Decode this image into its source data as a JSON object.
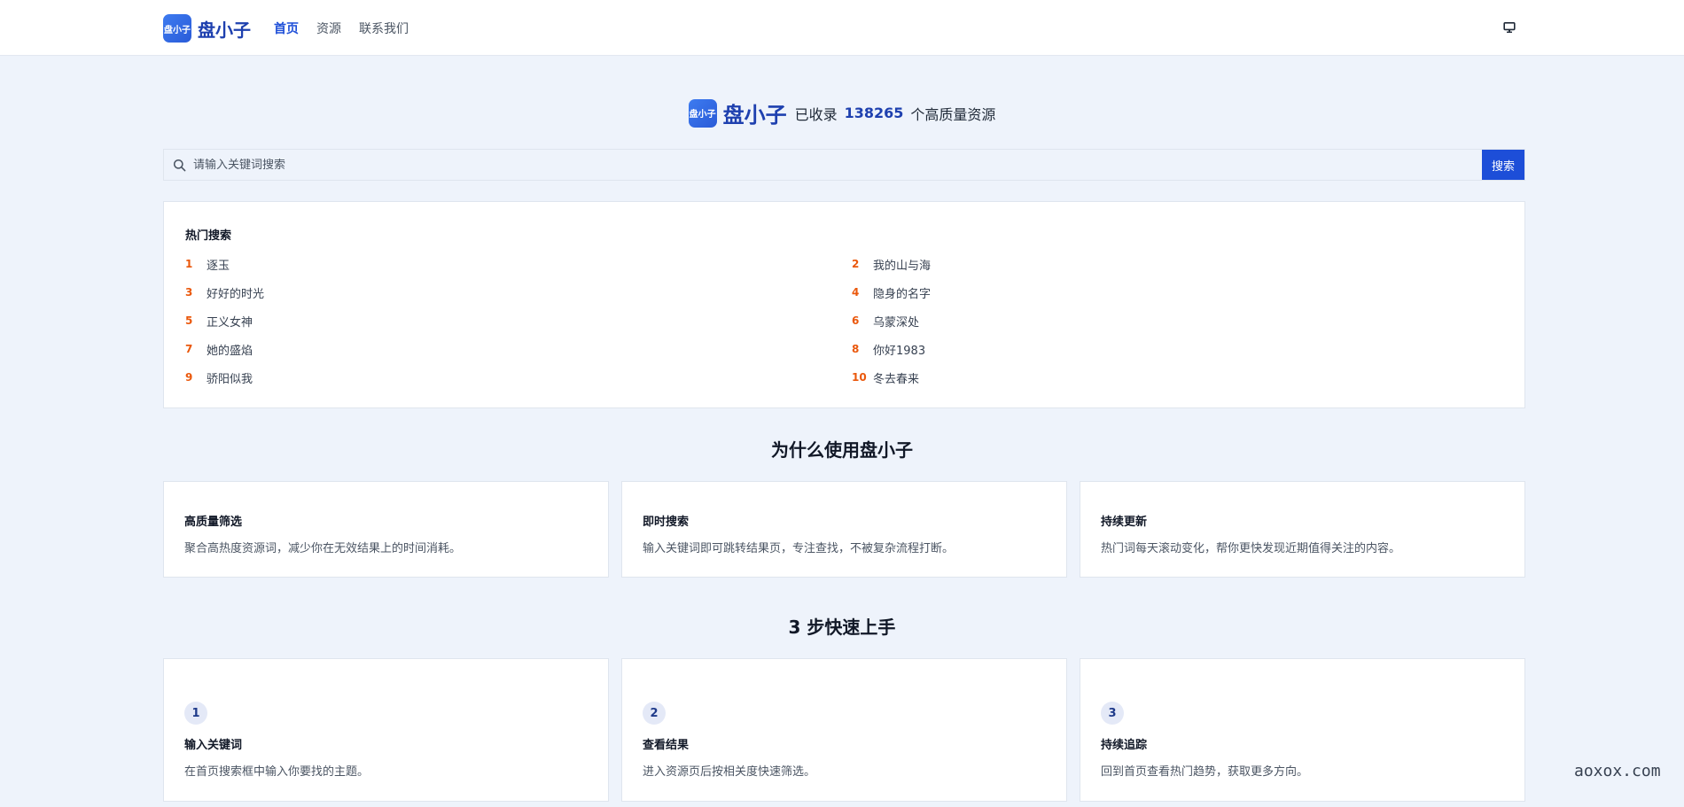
{
  "brand": {
    "logo_text": "盘小子",
    "name": "盘小子"
  },
  "nav": {
    "items": [
      {
        "label": "首页",
        "active": true
      },
      {
        "label": "资源",
        "active": false
      },
      {
        "label": "联系我们",
        "active": false
      }
    ]
  },
  "hero": {
    "name": "盘小子",
    "prefix": "已收录",
    "count": "138265",
    "suffix": "个高质量资源"
  },
  "search": {
    "placeholder": "请输入关键词搜索",
    "button_label": "搜索"
  },
  "hot": {
    "title": "热门搜索",
    "items": [
      {
        "rank": "1",
        "term": "逐玉"
      },
      {
        "rank": "2",
        "term": "我的山与海"
      },
      {
        "rank": "3",
        "term": "好好的时光"
      },
      {
        "rank": "4",
        "term": "隐身的名字"
      },
      {
        "rank": "5",
        "term": "正义女神"
      },
      {
        "rank": "6",
        "term": "乌蒙深处"
      },
      {
        "rank": "7",
        "term": "她的盛焰"
      },
      {
        "rank": "8",
        "term": "你好1983"
      },
      {
        "rank": "9",
        "term": "骄阳似我"
      },
      {
        "rank": "10",
        "term": "冬去春来"
      }
    ]
  },
  "why": {
    "title": "为什么使用盘小子",
    "cards": [
      {
        "title": "高质量筛选",
        "desc": "聚合高热度资源词，减少你在无效结果上的时间消耗。"
      },
      {
        "title": "即时搜索",
        "desc": "输入关键词即可跳转结果页，专注查找，不被复杂流程打断。"
      },
      {
        "title": "持续更新",
        "desc": "热门词每天滚动变化，帮你更快发现近期值得关注的内容。"
      }
    ]
  },
  "steps": {
    "title": "3 步快速上手",
    "cards": [
      {
        "number": "1",
        "title": "输入关键词",
        "desc": "在首页搜索框中输入你要找的主题。"
      },
      {
        "number": "2",
        "title": "查看结果",
        "desc": "进入资源页后按相关度快速筛选。"
      },
      {
        "number": "3",
        "title": "持续追踪",
        "desc": "回到首页查看热门趋势，获取更多方向。"
      }
    ]
  },
  "watermark": "aoxox.com",
  "colors": {
    "accent": "#1d4ed8",
    "rank": "#ea580c",
    "background": "#eef3fb"
  },
  "icons": {
    "display": "monitor-icon",
    "search": "search-icon"
  }
}
